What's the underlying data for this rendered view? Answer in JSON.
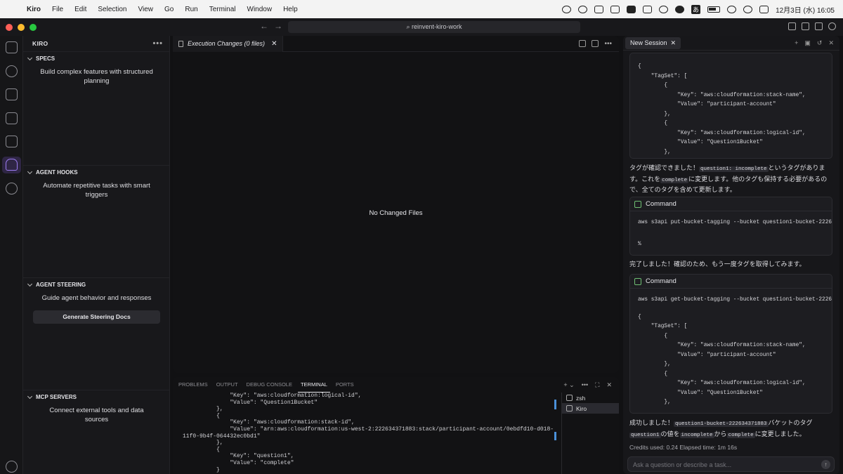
{
  "menubar": {
    "apple": "",
    "app": "Kiro",
    "items": [
      "File",
      "Edit",
      "Selection",
      "View",
      "Go",
      "Run",
      "Terminal",
      "Window",
      "Help"
    ],
    "ime": "あ",
    "datetime": "12月3日 (水) 16:05"
  },
  "window": {
    "command_center": "reinvent-kiro-work"
  },
  "sidebar": {
    "title": "KIRO",
    "more": "•••",
    "specs": {
      "header": "SPECS",
      "desc": "Build complex features with structured planning"
    },
    "hooks": {
      "header": "AGENT HOOKS",
      "desc": "Automate repetitive tasks with smart triggers"
    },
    "steering": {
      "header": "AGENT STEERING",
      "desc": "Guide agent behavior and responses",
      "button": "Generate Steering Docs"
    },
    "mcp": {
      "header": "MCP SERVERS",
      "desc": "Connect external tools and data sources"
    }
  },
  "editor": {
    "tab": "Execution Changes (0 files)",
    "empty": "No Changed Files"
  },
  "panel": {
    "tabs": [
      "PROBLEMS",
      "OUTPUT",
      "DEBUG CONSOLE",
      "TERMINAL",
      "PORTS"
    ],
    "active_tab": "TERMINAL",
    "terminal_lines": [
      "              \"Key\": \"aws:cloudformation:logical-id\",",
      "              \"Value\": \"Question1Bucket\"",
      "          },",
      "          {",
      "              \"Key\": \"aws:cloudformation:stack-id\",",
      "              \"Value\": \"arn:aws:cloudformation:us-west-2:222634371883:stack/participant-account/0ebdfd10-d018-",
      "11f0-9b4f-064432ec0bd1\"",
      "          },",
      "          {",
      "              \"Key\": \"question1\",",
      "              \"Value\": \"complete\"",
      "          }"
    ],
    "terminals": [
      "zsh",
      "Kiro"
    ]
  },
  "chat": {
    "tab": "New Session",
    "block1": [
      "{",
      "    \"TagSet\": [",
      "        {",
      "            \"Key\": \"aws:cloudformation:stack-name\",",
      "            \"Value\": \"participant-account\"",
      "        },",
      "        {",
      "            \"Key\": \"aws:cloudformation:logical-id\",",
      "            \"Value\": \"Question1Bucket\"",
      "        },"
    ],
    "msg1": {
      "t1": "タグが確認できました！",
      "c1": "question1: incomplete",
      "t2": "というタグがあります。これを",
      "c2": "complete",
      "t3": "に変更します。他のタグも保持する必要があるので、全てのタグを含めて更新します。"
    },
    "cmd1": {
      "title": "Command",
      "line": "aws s3api put-bucket-tagging --bucket question1-bucket-22263",
      "prompt": "%"
    },
    "msg2": "完了しました！確認のため、もう一度タグを取得してみます。",
    "cmd2": {
      "title": "Command",
      "line": "aws s3api get-bucket-tagging --bucket question1-bucket-22263",
      "json": [
        "{",
        "    \"TagSet\": [",
        "        {",
        "            \"Key\": \"aws:cloudformation:stack-name\",",
        "            \"Value\": \"participant-account\"",
        "        },",
        "        {",
        "            \"Key\": \"aws:cloudformation:logical-id\",",
        "            \"Value\": \"Question1Bucket\"",
        "        },"
      ]
    },
    "msg3": {
      "t1": "成功しました！",
      "c1": "question1-bucket-222634371883",
      "t2": "バケットのタグ",
      "c2": "question1",
      "t3": "の値を",
      "c3": "incomplete",
      "t4": "から",
      "c4": "complete",
      "t5": "に変更しました。"
    },
    "credits": "Credits used: 0.24   Elapsed time: 1m 16s",
    "input_placeholder": "Ask a question or describe a task..."
  }
}
